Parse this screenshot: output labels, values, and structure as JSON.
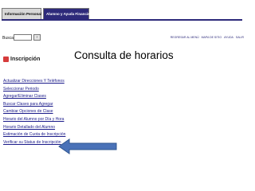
{
  "tabs": [
    {
      "label": "Información Personal"
    },
    {
      "label": "Alumno y Ayuda Financiera"
    }
  ],
  "search": {
    "label": "Buscar",
    "button": "Ir"
  },
  "top_links": [
    "REGRESAR AL MENÚ",
    "MAPA DE SITIO",
    "AYUDA",
    "SALIR"
  ],
  "logo": {
    "text": "Inscripción",
    "icon": "clipboard-icon"
  },
  "title": "Consulta de horarios",
  "menu": [
    "Actualizar Direcciones Y Teléfonos",
    "Seleccionar Periodo",
    "Agregar/Eliminar Clases",
    "Buscar Clases para Agregar",
    "Cambiar Opciones de Clase",
    "Horario del Alumno por Día y Hora",
    "Horario Detallado del Alumno",
    "Estimación de Cuota de Inscripción",
    "Verificar su Status de Inscripción"
  ],
  "colors": {
    "tab_active": "#2d2a7a",
    "link": "#1a1a8a",
    "arrow": "#4a72b8"
  }
}
